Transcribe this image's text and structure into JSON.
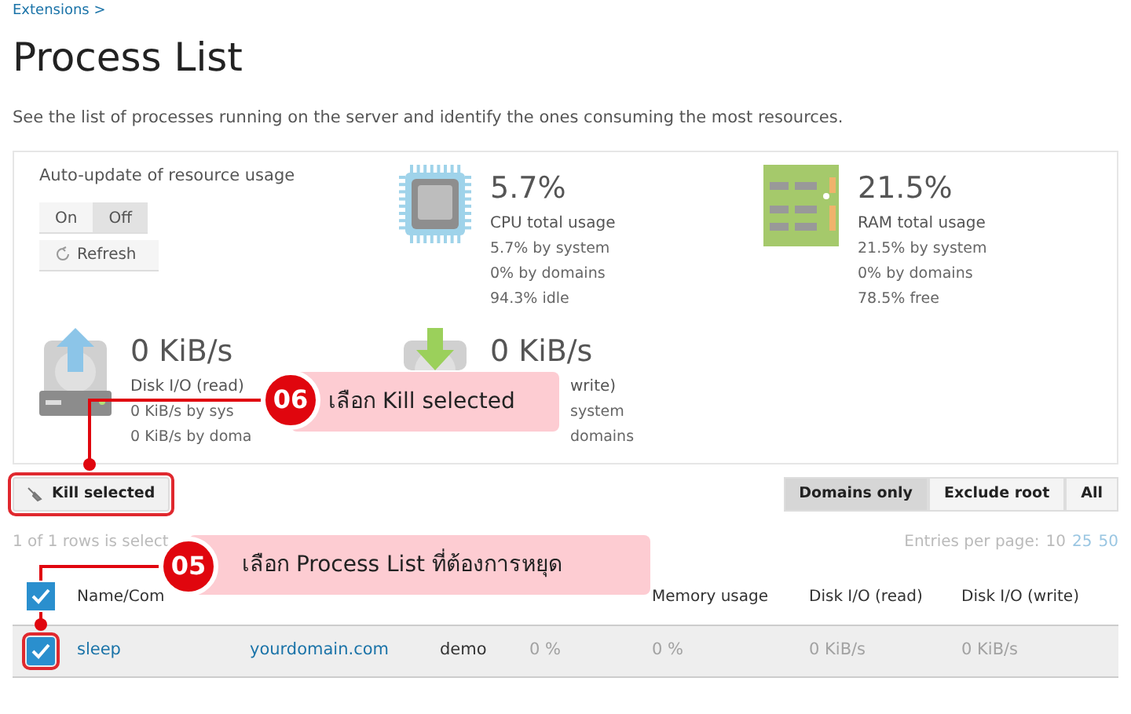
{
  "breadcrumb": "Extensions >",
  "title": "Process List",
  "description": "See the list of processes running on the server and identify the ones consuming the most resources.",
  "auto_update": {
    "label": "Auto-update of resource usage",
    "options": [
      {
        "label": "On",
        "selected": false
      },
      {
        "label": "Off",
        "selected": true
      }
    ],
    "refresh": "Refresh"
  },
  "stats": [
    {
      "kind": "cpu",
      "value": "5.7%",
      "label": "CPU total usage",
      "lines": [
        "5.7% by system",
        "0% by domains",
        "94.3% idle"
      ]
    },
    {
      "kind": "ram",
      "value": "21.5%",
      "label": "RAM total usage",
      "lines": [
        "21.5% by system",
        "0% by domains",
        "78.5% free"
      ]
    },
    {
      "kind": "disk_read",
      "value": "0 KiB/s",
      "label": "Disk I/O (read)",
      "lines": [
        "0 KiB/s by sys",
        "0 KiB/s by doma"
      ]
    },
    {
      "kind": "disk_write",
      "value": "0 KiB/s",
      "label": "write)",
      "lines": [
        "system",
        "domains"
      ]
    }
  ],
  "kill_button": "Kill selected",
  "filters": [
    {
      "label": "Domains only",
      "selected": true
    },
    {
      "label": "Exclude root",
      "selected": false
    },
    {
      "label": "All",
      "selected": false
    }
  ],
  "selection_info": "1 of 1 rows is select",
  "entries": {
    "label": "Entries per page:",
    "options": [
      {
        "label": "10",
        "selected": true
      },
      {
        "label": "25",
        "selected": false
      },
      {
        "label": "50",
        "selected": false
      }
    ]
  },
  "table": {
    "all_checked": true,
    "columns": [
      {
        "header": "Name/Com"
      },
      {},
      {},
      {},
      {
        "header": "Memory usage"
      },
      {
        "header": "Disk I/O (read)"
      },
      {
        "header": "Disk I/O (write)"
      }
    ],
    "rows": [
      {
        "selected": true,
        "cells": [
          {
            "text": "sleep",
            "kind": "link"
          },
          {
            "text": "yourdomain.com",
            "kind": "link"
          },
          {
            "text": "demo",
            "kind": "text"
          },
          {
            "text": "0 %",
            "kind": "muted"
          },
          {
            "text": "0 %",
            "kind": "muted"
          },
          {
            "text": "0 KiB/s",
            "kind": "muted"
          },
          {
            "text": "0 KiB/s",
            "kind": "muted"
          }
        ]
      }
    ]
  },
  "callouts": [
    {
      "number": "06",
      "text": "เลือก Kill selected"
    },
    {
      "number": "05",
      "text": "เลือก Process List ที่ต้องการหยุด"
    }
  ]
}
